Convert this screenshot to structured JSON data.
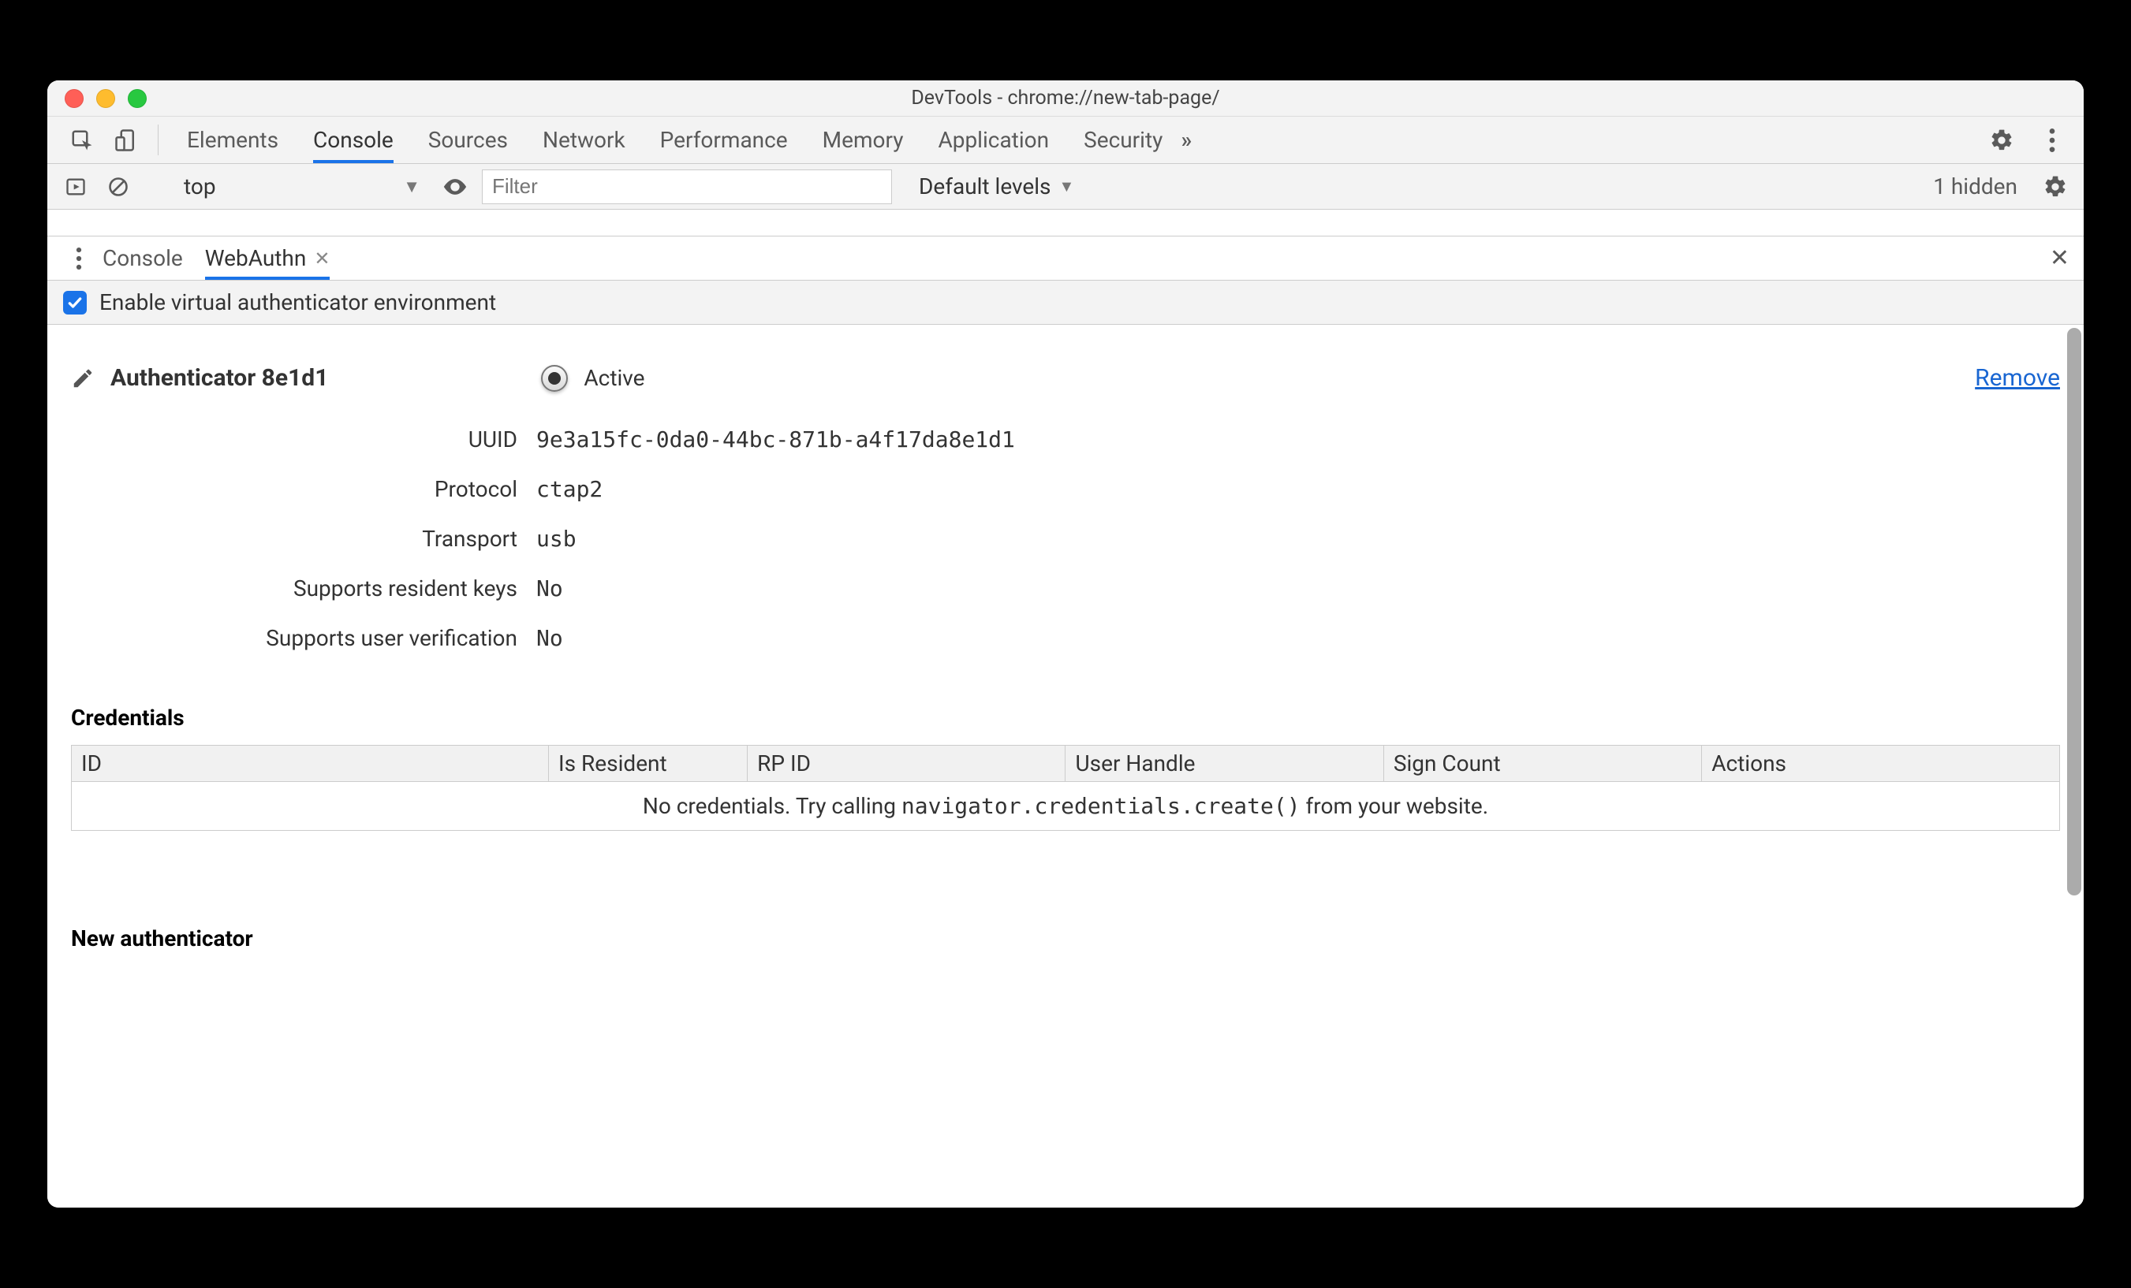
{
  "window": {
    "title": "DevTools - chrome://new-tab-page/"
  },
  "main_tabs": {
    "items": [
      "Elements",
      "Console",
      "Sources",
      "Network",
      "Performance",
      "Memory",
      "Application",
      "Security"
    ],
    "active_index": 1
  },
  "console_toolbar": {
    "context": "top",
    "filter_placeholder": "Filter",
    "levels_label": "Default levels",
    "hidden_text": "1 hidden"
  },
  "drawer": {
    "tabs": [
      {
        "label": "Console",
        "active": false,
        "closable": false
      },
      {
        "label": "WebAuthn",
        "active": true,
        "closable": true
      }
    ]
  },
  "enable_row": {
    "checked": true,
    "label": "Enable virtual authenticator environment"
  },
  "authenticator": {
    "title": "Authenticator 8e1d1",
    "active_label": "Active",
    "remove_label": "Remove",
    "fields": {
      "uuid_label": "UUID",
      "uuid": "9e3a15fc-0da0-44bc-871b-a4f17da8e1d1",
      "protocol_label": "Protocol",
      "protocol": "ctap2",
      "transport_label": "Transport",
      "transport": "usb",
      "resident_label": "Supports resident keys",
      "resident": "No",
      "uv_label": "Supports user verification",
      "uv": "No"
    }
  },
  "credentials": {
    "section_title": "Credentials",
    "columns": [
      "ID",
      "Is Resident",
      "RP ID",
      "User Handle",
      "Sign Count",
      "Actions"
    ],
    "empty_prefix": "No credentials. Try calling ",
    "empty_code": "navigator.credentials.create()",
    "empty_suffix": " from your website."
  },
  "new_authenticator": {
    "title": "New authenticator"
  }
}
